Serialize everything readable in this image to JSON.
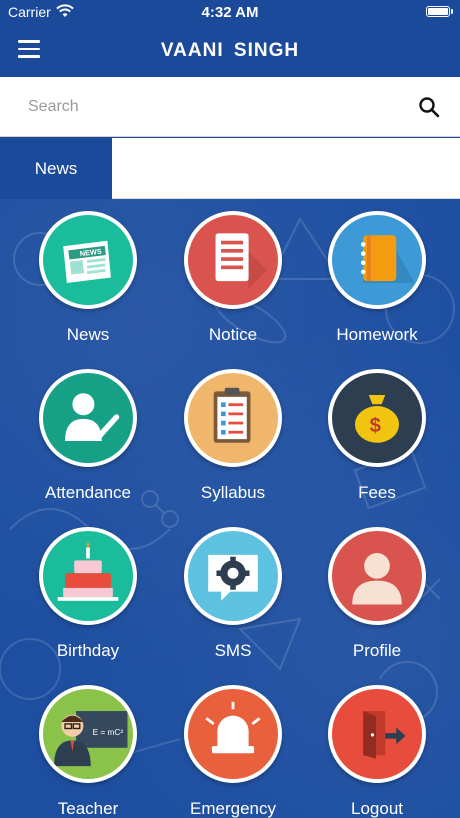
{
  "status": {
    "carrier": "Carrier",
    "time": "4:32 AM"
  },
  "header": {
    "title": "VAANI  SINGH"
  },
  "search": {
    "placeholder": "Search",
    "value": ""
  },
  "tabs": [
    {
      "label": "News"
    }
  ],
  "tiles": [
    {
      "label": "News",
      "icon": "newspaper-icon",
      "color": "#1abc9c"
    },
    {
      "label": "Notice",
      "icon": "notice-document-icon",
      "color": "#e74c3c"
    },
    {
      "label": "Homework",
      "icon": "notebook-icon",
      "color": "#3498db"
    },
    {
      "label": "Attendance",
      "icon": "person-check-icon",
      "color": "#16a085"
    },
    {
      "label": "Syllabus",
      "icon": "clipboard-checklist-icon",
      "color": "#f1c27d"
    },
    {
      "label": "Fees",
      "icon": "money-bag-icon",
      "color": "#2c3e50"
    },
    {
      "label": "Birthday",
      "icon": "birthday-cake-icon",
      "color": "#1abc9c"
    },
    {
      "label": "SMS",
      "icon": "sms-gear-icon",
      "color": "#5dc1e0"
    },
    {
      "label": "Profile",
      "icon": "user-profile-icon",
      "color": "#e74c3c"
    },
    {
      "label": "Teacher",
      "icon": "teacher-icon",
      "color": "#8bc34a"
    },
    {
      "label": "Emergency",
      "icon": "emergency-siren-icon",
      "color": "#e8603c"
    },
    {
      "label": "Logout",
      "icon": "logout-door-icon",
      "color": "#e74c3c"
    }
  ]
}
